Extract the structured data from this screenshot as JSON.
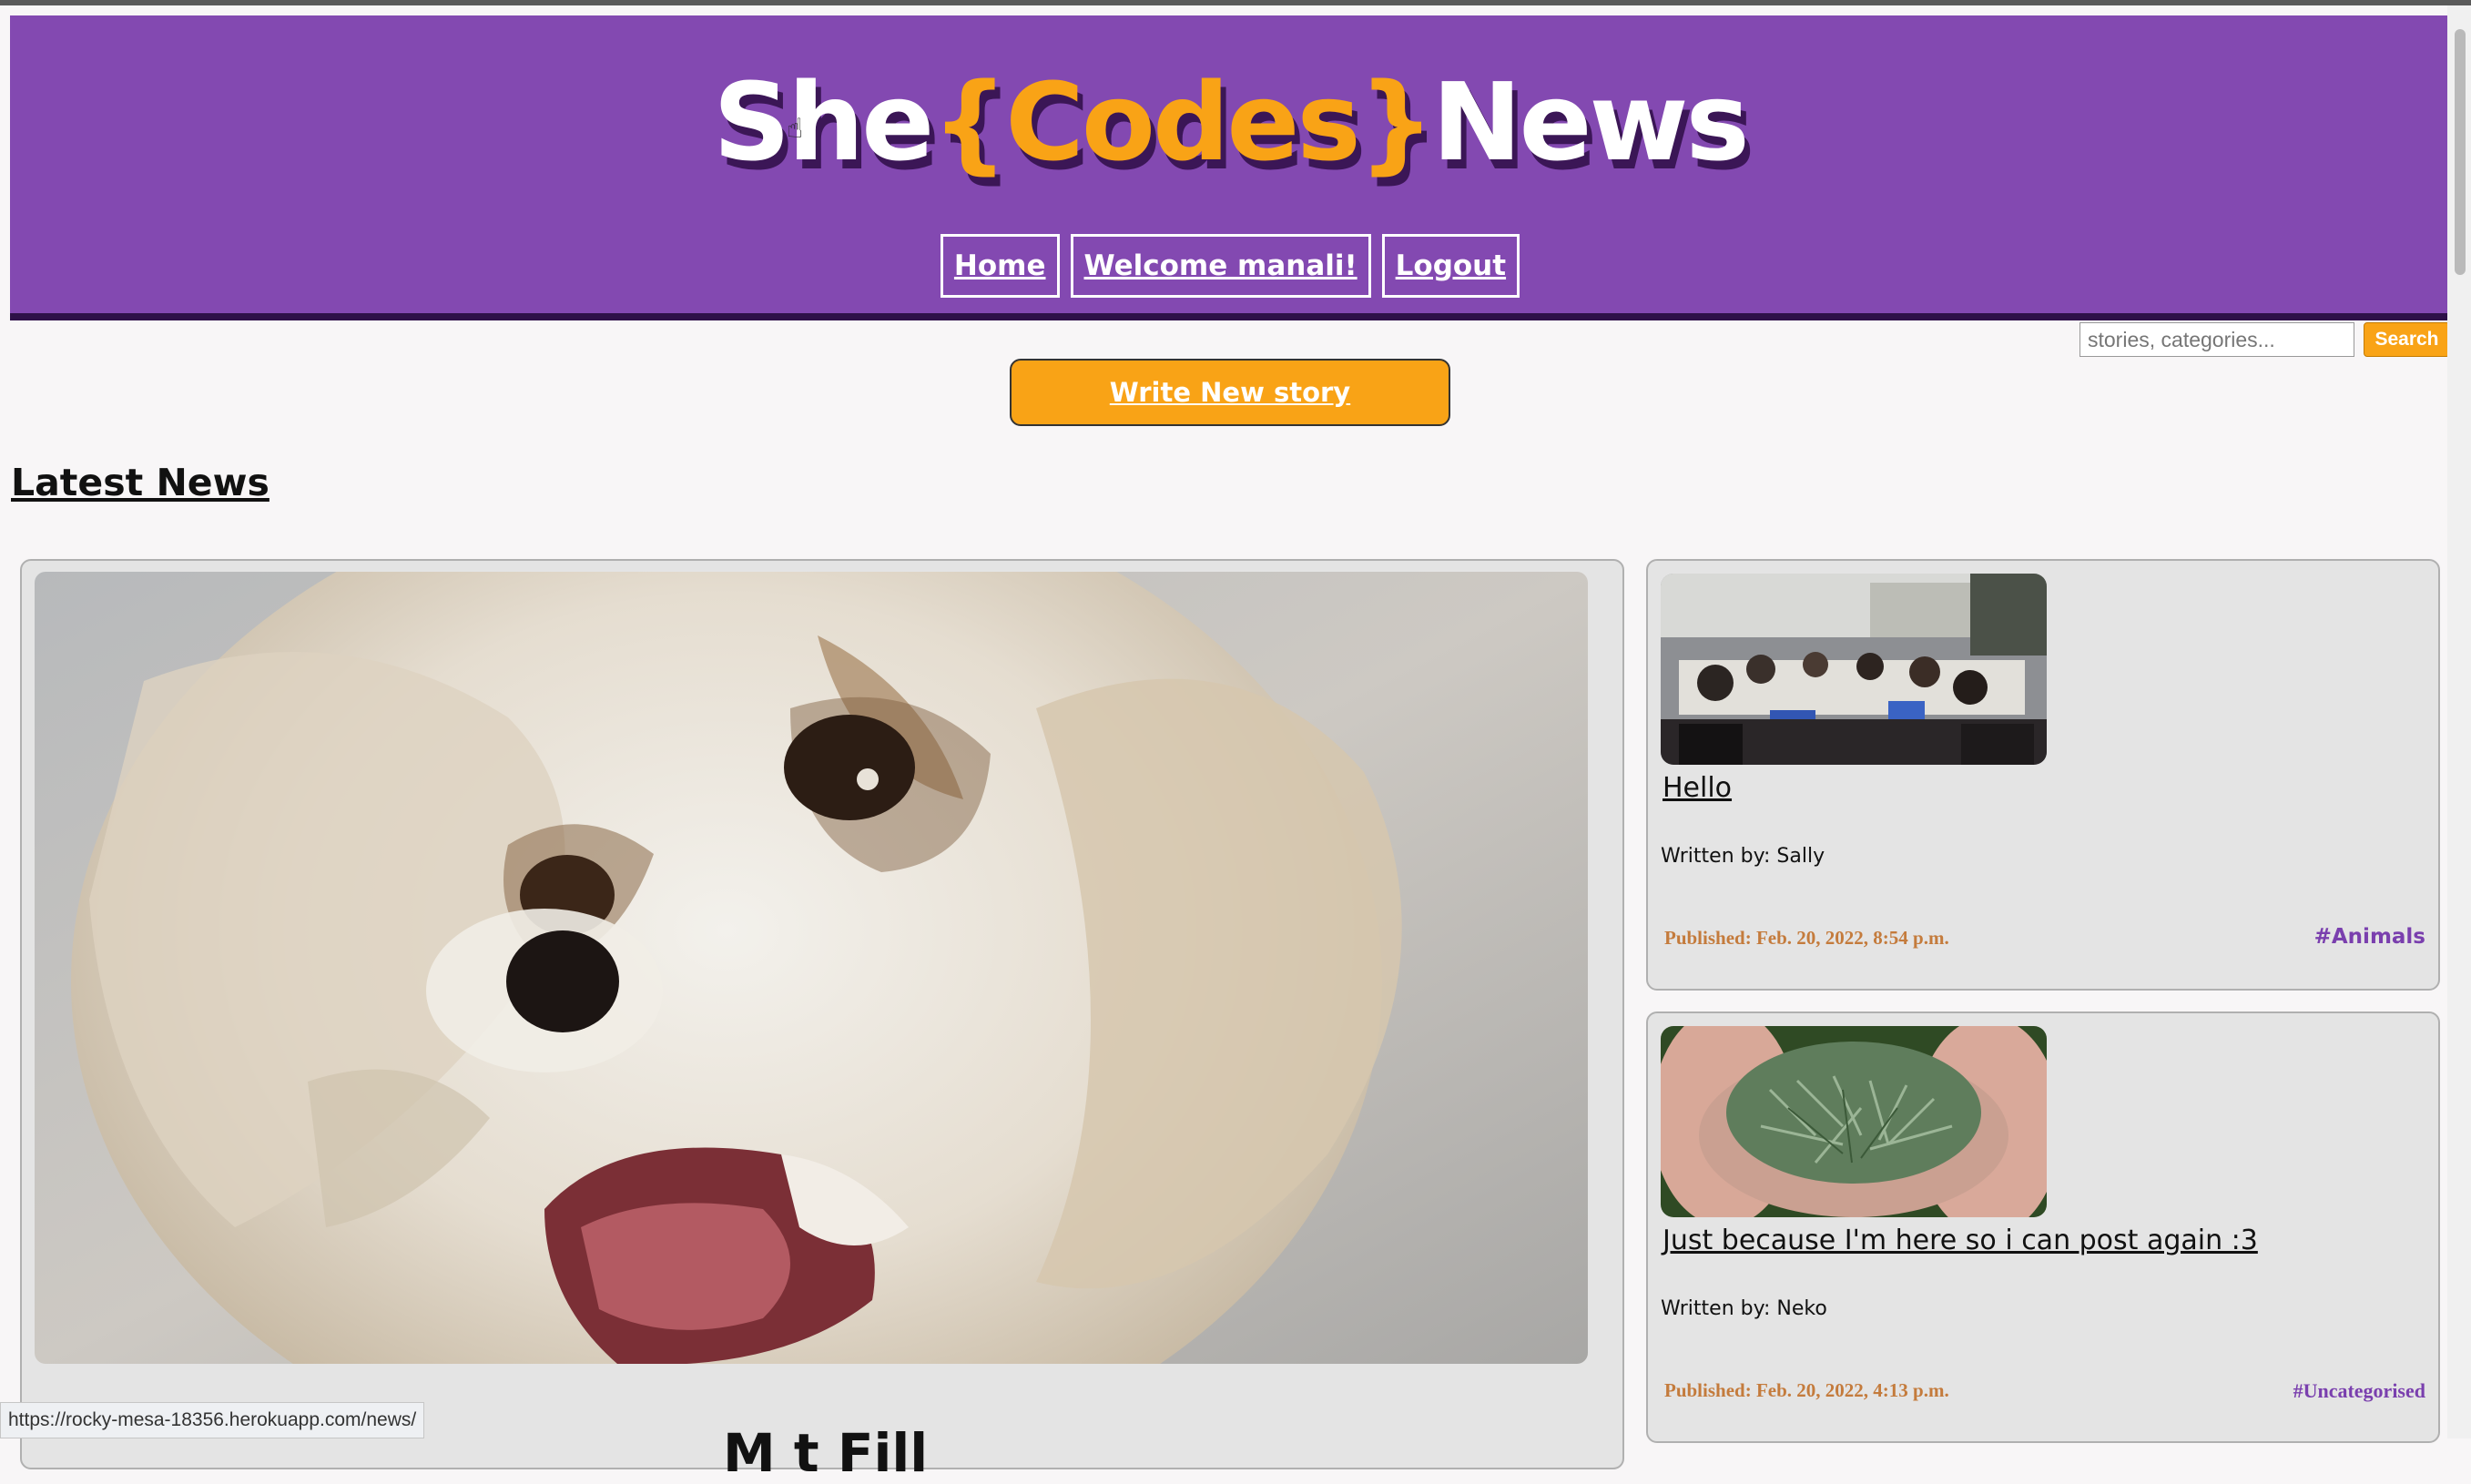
{
  "header": {
    "logo_she": "She",
    "logo_open_brace": "{",
    "logo_codes": "Codes",
    "logo_close_brace": "}",
    "logo_news": "News",
    "nav": [
      "Home",
      "Welcome manali!",
      "Logout"
    ]
  },
  "search": {
    "placeholder": "stories, categories...",
    "button": "Search"
  },
  "write_button": "Write New story",
  "section_title": "Latest News",
  "featured": {
    "image": "painted white dog portrait",
    "title_peek": "M  t Fill"
  },
  "stories": [
    {
      "title": "Hello",
      "author": "Written by: Sally",
      "published": "Published: Feb. 20, 2022, 8:54 p.m.",
      "category": "#Animals",
      "image": "group of people at laptops"
    },
    {
      "title": "Just because I'm here so i can post again :3",
      "author": "Written by: Neko",
      "published": "Published: Feb. 20, 2022, 4:13 p.m.",
      "category": "#Uncategorised",
      "image": "hands holding pine shoots"
    }
  ],
  "status_url": "https://rocky-mesa-18356.herokuapp.com/news/",
  "colors": {
    "header_purple": "#8349b1",
    "accent_orange": "#f9a316",
    "card_grey": "#e4e4e4"
  }
}
